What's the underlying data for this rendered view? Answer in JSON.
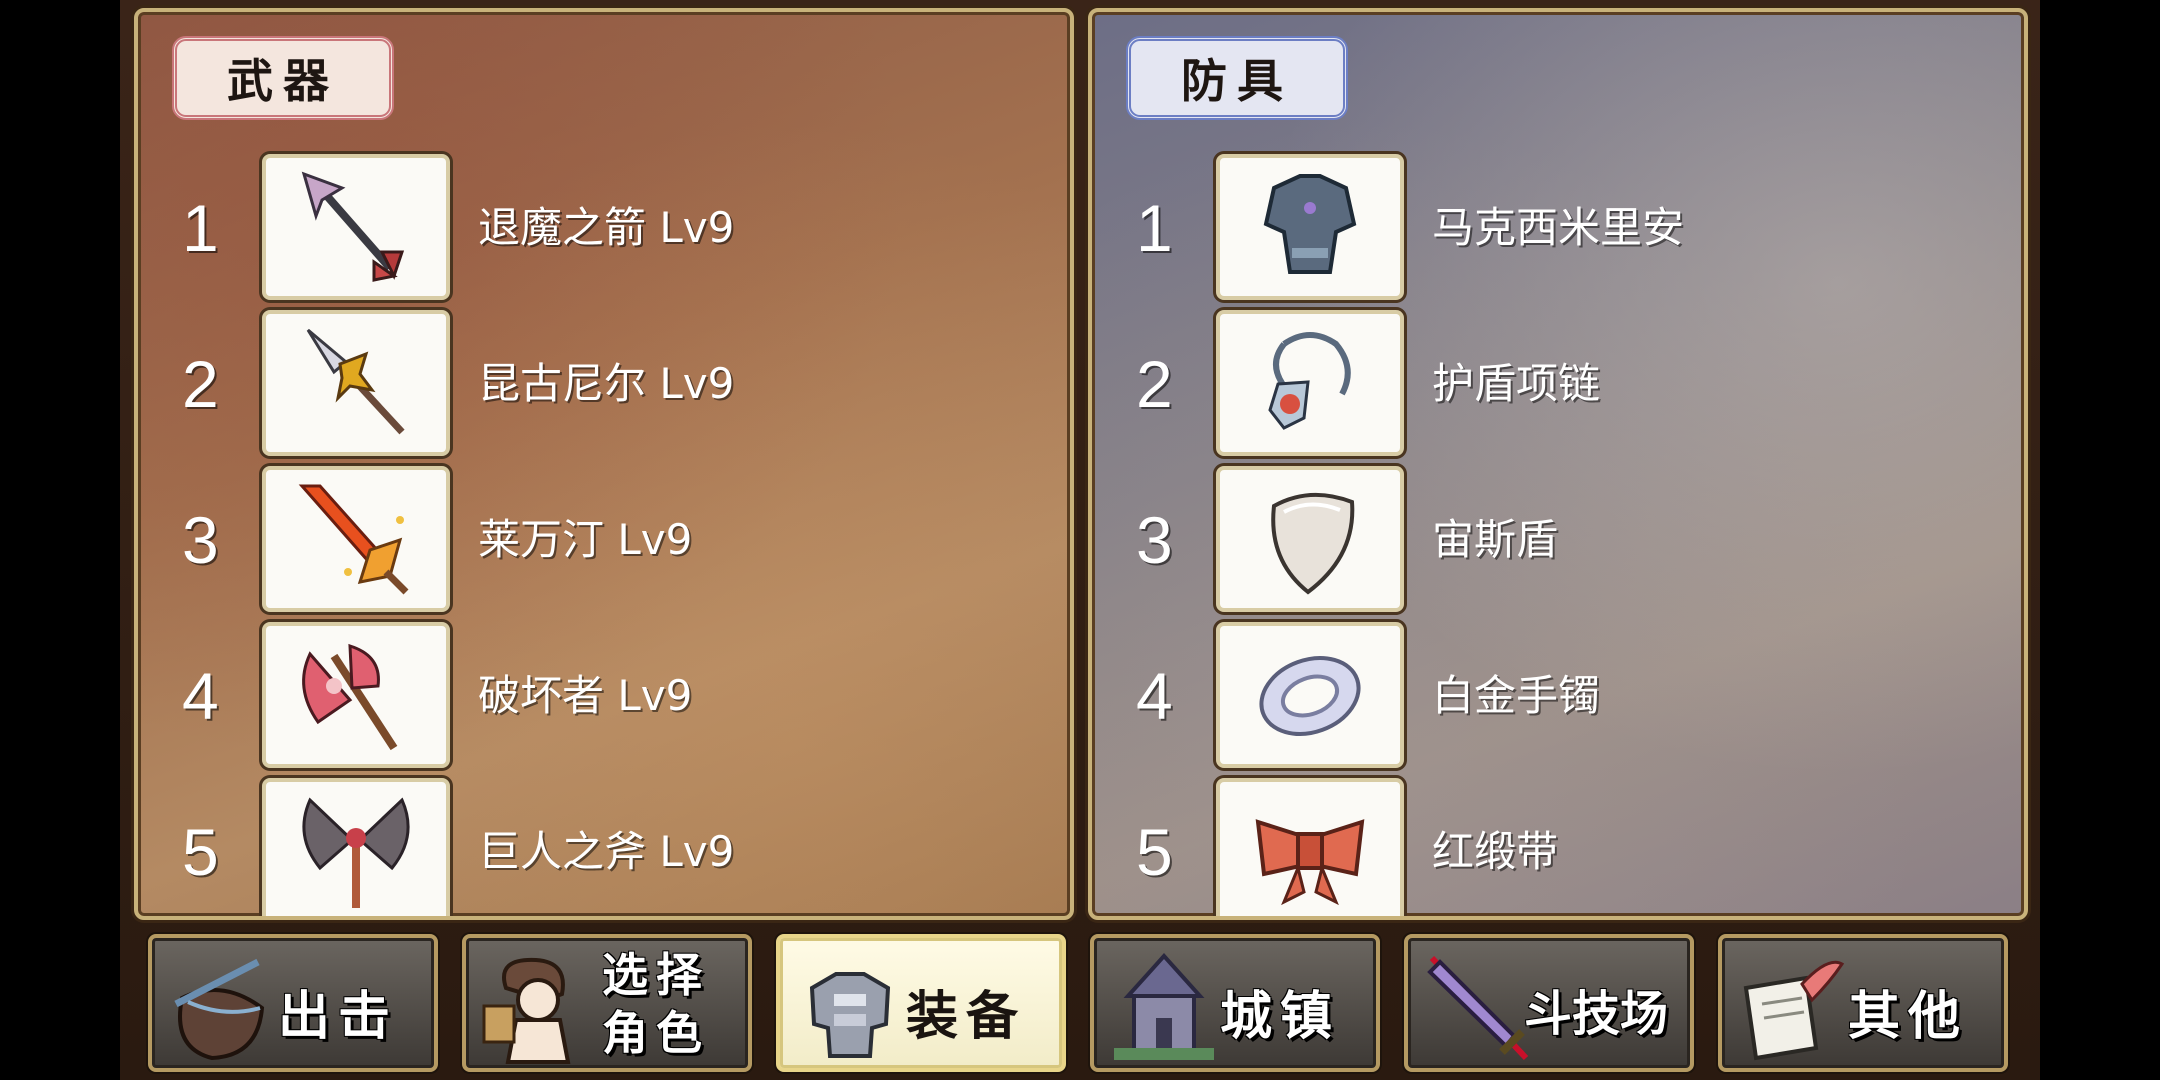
{
  "weapon_panel": {
    "title": "武器",
    "items": [
      {
        "num": "1",
        "name": "退魔之箭 Lv9",
        "icon": "arrow-icon"
      },
      {
        "num": "2",
        "name": "昆古尼尔 Lv9",
        "icon": "spear-icon"
      },
      {
        "num": "3",
        "name": "莱万汀 Lv9",
        "icon": "flame-sword-icon"
      },
      {
        "num": "4",
        "name": "破坏者 Lv9",
        "icon": "battle-axe-icon"
      },
      {
        "num": "5",
        "name": "巨人之斧 Lv9",
        "icon": "giant-axe-icon"
      }
    ]
  },
  "armor_panel": {
    "title": "防具",
    "items": [
      {
        "num": "1",
        "name": "马克西米里安",
        "icon": "plate-armor-icon"
      },
      {
        "num": "2",
        "name": "护盾项链",
        "icon": "necklace-icon"
      },
      {
        "num": "3",
        "name": "宙斯盾",
        "icon": "shield-icon"
      },
      {
        "num": "4",
        "name": "白金手镯",
        "icon": "bracelet-icon"
      },
      {
        "num": "5",
        "name": "红缎带",
        "icon": "ribbon-icon"
      }
    ]
  },
  "nav": {
    "sortie": "出击",
    "select_line1": "选择",
    "select_line2": "角色",
    "equipment": "装备",
    "town": "城镇",
    "arena": "斗技场",
    "other": "其他",
    "active": "equipment",
    "icons": [
      "bag-icon",
      "character-icon",
      "armor-icon",
      "castle-icon",
      "sword-icon",
      "scroll-icon"
    ]
  }
}
